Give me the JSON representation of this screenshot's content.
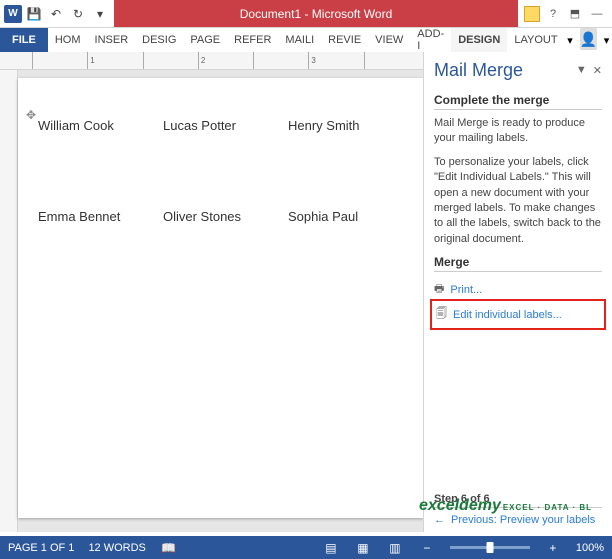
{
  "title": "Document1 - Microsoft Word",
  "qat": {
    "save": "💾",
    "undo": "↶",
    "redo": "↻"
  },
  "tabs": {
    "file": "FILE",
    "list": [
      "HOM",
      "INSER",
      "DESIG",
      "PAGE",
      "REFER",
      "MAILI",
      "REVIE",
      "VIEW",
      "ADD-I",
      "DESIGN",
      "LAYOUT"
    ],
    "active": 9
  },
  "ruler": [
    "",
    "1",
    "",
    "2",
    "",
    "3",
    ""
  ],
  "labels": [
    [
      "William Cook",
      "Lucas Potter",
      "Henry Smith"
    ],
    [
      "Emma Bennet",
      "Oliver Stones",
      "Sophia Paul"
    ]
  ],
  "pane": {
    "title": "Mail Merge",
    "section1": "Complete the merge",
    "p1": "Mail Merge is ready to produce your mailing labels.",
    "p2": "To personalize your labels, click \"Edit Individual Labels.\" This will open a new document with your merged labels. To make changes to all the labels, switch back to the original document.",
    "section2": "Merge",
    "print": "Print...",
    "edit": "Edit individual labels...",
    "step": "Step 6 of 6",
    "prev": "Previous: Preview your labels"
  },
  "status": {
    "page": "PAGE 1 OF 1",
    "words": "12 WORDS",
    "zoom": "100%"
  },
  "watermark": {
    "brand": "exceldemy",
    "tag": "EXCEL · DATA · BL"
  }
}
